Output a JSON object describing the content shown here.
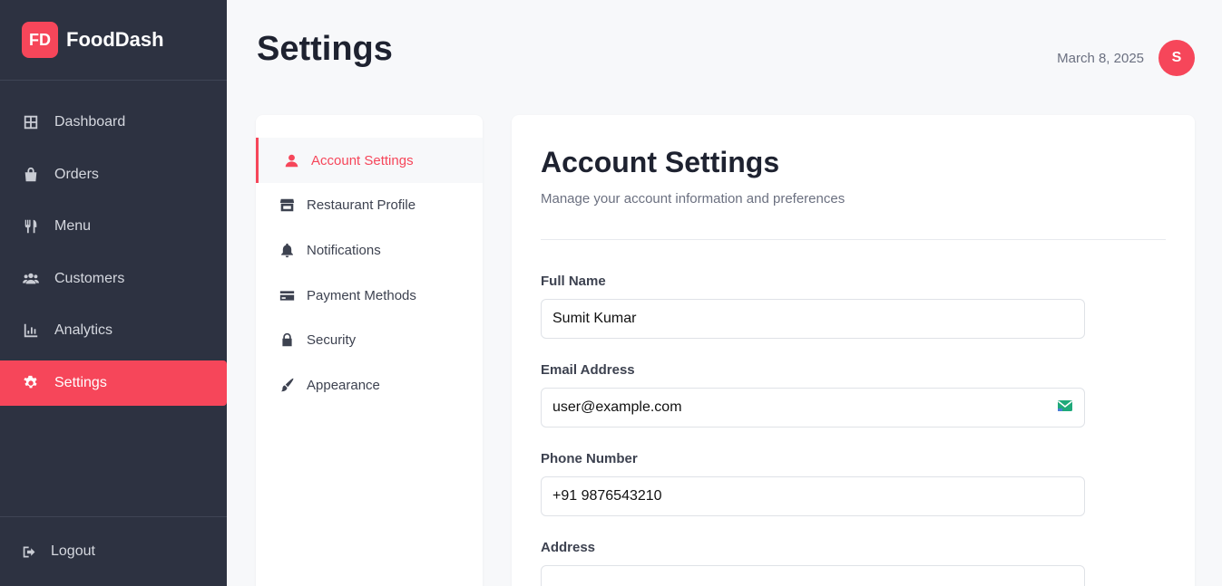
{
  "brand": {
    "logo": "FD",
    "name": "FoodDash"
  },
  "sidebar": {
    "items": [
      {
        "label": "Dashboard",
        "icon": "grid-icon",
        "active": false
      },
      {
        "label": "Orders",
        "icon": "bag-icon",
        "active": false
      },
      {
        "label": "Menu",
        "icon": "utensils-icon",
        "active": false
      },
      {
        "label": "Customers",
        "icon": "users-icon",
        "active": false
      },
      {
        "label": "Analytics",
        "icon": "chart-icon",
        "active": false
      },
      {
        "label": "Settings",
        "icon": "gear-icon",
        "active": true
      }
    ],
    "logout": "Logout"
  },
  "header": {
    "title": "Settings",
    "date": "March 8, 2025",
    "avatar": "S"
  },
  "settings_nav": {
    "items": [
      {
        "label": "Account Settings",
        "icon": "user-icon",
        "active": true
      },
      {
        "label": "Restaurant Profile",
        "icon": "store-icon",
        "active": false
      },
      {
        "label": "Notifications",
        "icon": "bell-icon",
        "active": false
      },
      {
        "label": "Payment Methods",
        "icon": "card-icon",
        "active": false
      },
      {
        "label": "Security",
        "icon": "lock-icon",
        "active": false
      },
      {
        "label": "Appearance",
        "icon": "brush-icon",
        "active": false
      }
    ]
  },
  "main": {
    "title": "Account Settings",
    "subtitle": "Manage your account information and preferences",
    "fields": [
      {
        "label": "Full Name",
        "value": "Sumit Kumar"
      },
      {
        "label": "Email Address",
        "value": "user@example.com"
      },
      {
        "label": "Phone Number",
        "value": "+91 9876543210"
      },
      {
        "label": "Address",
        "value": ""
      }
    ]
  },
  "colors": {
    "accent": "#f6465a",
    "sidebar_bg": "#2d3241",
    "page_bg": "#f7f8fa"
  }
}
